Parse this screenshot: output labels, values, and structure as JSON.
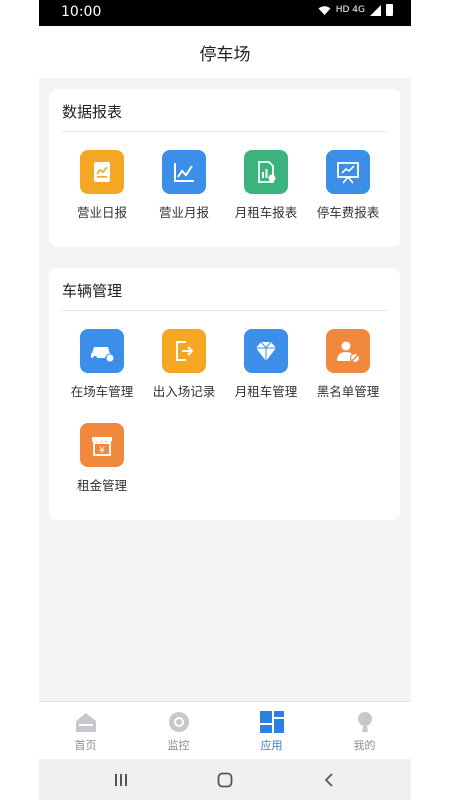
{
  "status_bar": {
    "time": "10:00",
    "network": "HD 4G"
  },
  "header": {
    "title": "停车场"
  },
  "sections": [
    {
      "title": "数据报表",
      "items": [
        {
          "label": "营业日报",
          "icon": "daily-report-icon",
          "color": "#f5a623"
        },
        {
          "label": "营业月报",
          "icon": "line-chart-icon",
          "color": "#3b8fe8"
        },
        {
          "label": "月租车报表",
          "icon": "document-chart-icon",
          "color": "#3bb37c"
        },
        {
          "label": "停车费报表",
          "icon": "presentation-board-icon",
          "color": "#3b8fe8"
        }
      ]
    },
    {
      "title": "车辆管理",
      "items": [
        {
          "label": "在场车管理",
          "icon": "car-clock-icon",
          "color": "#3b8fe8"
        },
        {
          "label": "出入场记录",
          "icon": "exit-door-icon",
          "color": "#f5a623"
        },
        {
          "label": "月租车管理",
          "icon": "diamond-icon",
          "color": "#3b8fe8"
        },
        {
          "label": "黑名单管理",
          "icon": "user-block-icon",
          "color": "#f0883e"
        },
        {
          "label": "租金管理",
          "icon": "rent-shop-icon",
          "color": "#f0883e"
        }
      ]
    }
  ],
  "tab_bar": {
    "active": "应用",
    "items": [
      {
        "label": "首页",
        "icon": "home-icon"
      },
      {
        "label": "监控",
        "icon": "camera-icon"
      },
      {
        "label": "应用",
        "icon": "apps-grid-icon"
      },
      {
        "label": "我的",
        "icon": "profile-icon"
      }
    ]
  },
  "system_nav": {
    "recent": "recent-apps-icon",
    "home": "home-button-icon",
    "back": "back-icon"
  },
  "colors": {
    "accent": "#2d7fe0",
    "orange": "#f5a623",
    "blue": "#3b8fe8",
    "green": "#3bb37c",
    "background": "#f4f3f6"
  }
}
